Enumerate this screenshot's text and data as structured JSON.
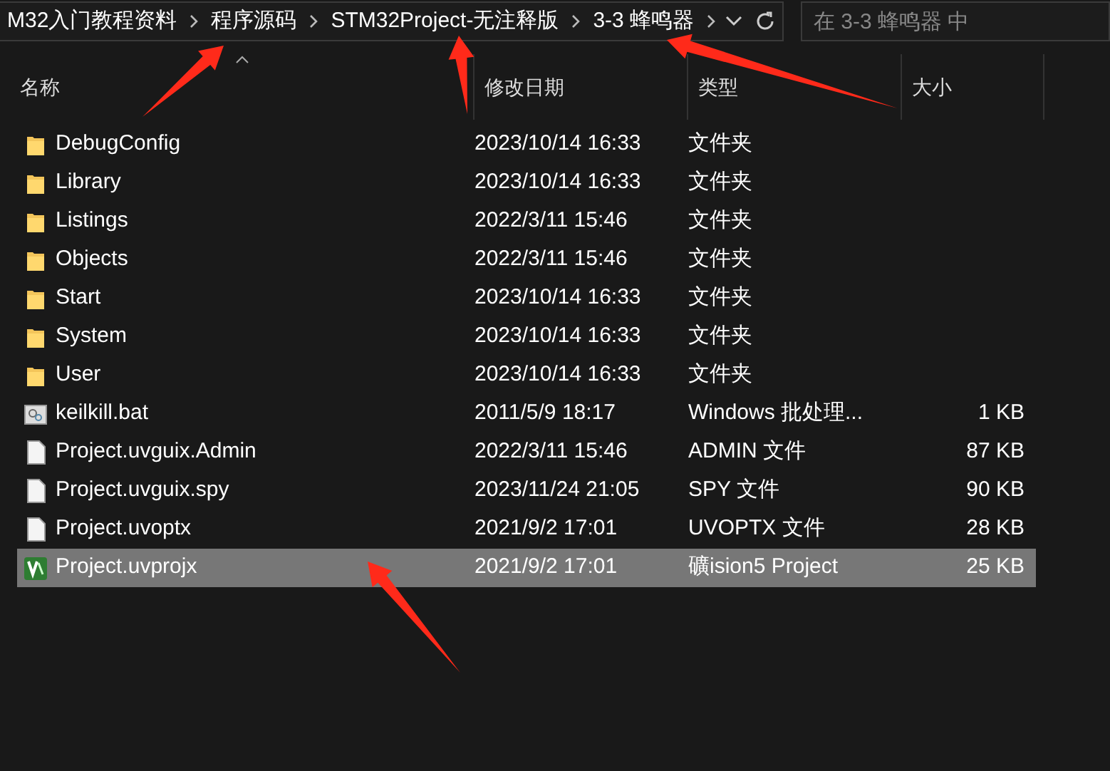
{
  "breadcrumb": [
    "M32入门教程资料",
    "程序源码",
    "STM32Project-无注释版",
    "3-3 蜂鸣器"
  ],
  "search": {
    "placeholder": "在 3-3 蜂鸣器 中"
  },
  "columns": [
    "名称",
    "修改日期",
    "类型",
    "大小"
  ],
  "rows": [
    {
      "kind": "folder",
      "name": "DebugConfig",
      "date": "2023/10/14 16:33",
      "type": "文件夹",
      "selected": false
    },
    {
      "kind": "folder",
      "name": "Library",
      "date": "2023/10/14 16:33",
      "type": "文件夹",
      "selected": false
    },
    {
      "kind": "folder",
      "name": "Listings",
      "date": "2022/3/11 15:46",
      "type": "文件夹",
      "selected": false
    },
    {
      "kind": "folder",
      "name": "Objects",
      "date": "2022/3/11 15:46",
      "type": "文件夹",
      "selected": false
    },
    {
      "kind": "folder",
      "name": "Start",
      "date": "2023/10/14 16:33",
      "type": "文件夹",
      "selected": false
    },
    {
      "kind": "folder",
      "name": "System",
      "date": "2023/10/14 16:33",
      "type": "文件夹",
      "selected": false
    },
    {
      "kind": "folder",
      "name": "User",
      "date": "2023/10/14 16:33",
      "type": "文件夹",
      "selected": false
    },
    {
      "kind": "batch",
      "name": "keilkill.bat",
      "date": "2011/5/9 18:17",
      "type": "Windows 批处理...",
      "size": "1 KB",
      "selected": false
    },
    {
      "kind": "file",
      "name": "Project.uvguix.Admin",
      "date": "2022/3/11 15:46",
      "type": "ADMIN 文件",
      "size": "87 KB",
      "selected": false
    },
    {
      "kind": "file",
      "name": "Project.uvguix.spy",
      "date": "2023/11/24 21:05",
      "type": "SPY 文件",
      "size": "90 KB",
      "selected": false
    },
    {
      "kind": "file",
      "name": "Project.uvoptx",
      "date": "2021/9/2 17:01",
      "type": "UVOPTX 文件",
      "size": "28 KB",
      "selected": false
    },
    {
      "kind": "project",
      "name": "Project.uvprojx",
      "date": "2021/9/2 17:01",
      "type": "礦ision5 Project",
      "size": "25 KB",
      "selected": true
    }
  ]
}
